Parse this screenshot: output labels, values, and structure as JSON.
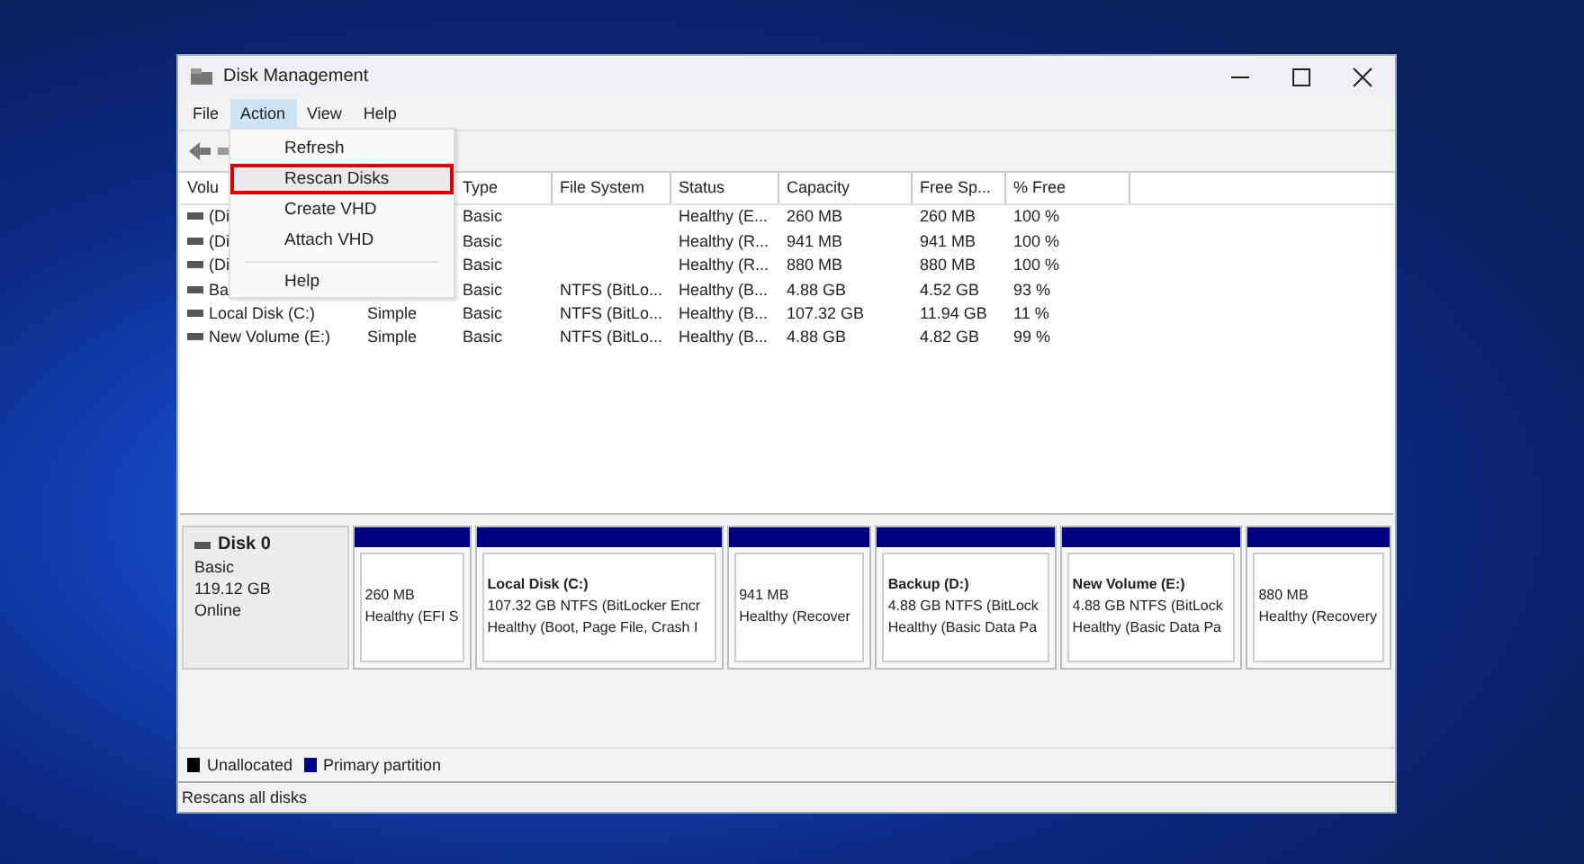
{
  "window": {
    "title": "Disk Management"
  },
  "menu_bar": [
    {
      "label": "File",
      "selected": false
    },
    {
      "label": "Action",
      "selected": true
    },
    {
      "label": "View",
      "selected": false
    },
    {
      "label": "Help",
      "selected": false
    }
  ],
  "action_menu": [
    {
      "kind": "item",
      "label": "Refresh",
      "selected": false
    },
    {
      "kind": "item",
      "label": "Rescan Disks",
      "selected": true
    },
    {
      "kind": "item",
      "label": "Create VHD",
      "selected": false
    },
    {
      "kind": "item",
      "label": "Attach VHD",
      "selected": false
    },
    {
      "kind": "separator"
    },
    {
      "kind": "item",
      "label": "Help",
      "selected": false
    }
  ],
  "table": {
    "columns": [
      "Volu",
      null,
      "Type",
      "File System",
      "Status",
      "Capacity",
      "Free Sp...",
      "% Free"
    ],
    "rows": [
      [
        "(Di",
        null,
        "Basic",
        null,
        "Healthy (E...",
        "260 MB",
        "260 MB",
        "100 %"
      ],
      [
        "(Di",
        null,
        "Basic",
        null,
        "Healthy (R...",
        "941 MB",
        "941 MB",
        "100 %"
      ],
      [
        "(Di",
        null,
        "Basic",
        null,
        "Healthy (R...",
        "880 MB",
        "880 MB",
        "100 %"
      ],
      [
        "Ba",
        null,
        "Basic",
        "NTFS (BitLo...",
        "Healthy (B...",
        "4.88 GB",
        "4.52 GB",
        "93 %"
      ],
      [
        "Local Disk (C:)",
        "Simple",
        "Basic",
        "NTFS (BitLo...",
        "Healthy (B...",
        "107.32 GB",
        "11.94 GB",
        "11 %"
      ],
      [
        "New Volume (E:)",
        "Simple",
        "Basic",
        "NTFS (BitLo...",
        "Healthy (B...",
        "4.88 GB",
        "4.82 GB",
        "99 %"
      ]
    ]
  },
  "disk": {
    "name": "Disk 0",
    "type": "Basic",
    "size": "119.12 GB",
    "state": "Online",
    "partitions": [
      {
        "line1": "260 MB",
        "line2": "Healthy (EFI S"
      },
      {
        "title": "Local Disk  (C:)",
        "line1": "107.32 GB NTFS (BitLocker Encr",
        "line2": "Healthy (Boot, Page File, Crash I"
      },
      {
        "line1": "941 MB",
        "line2": "Healthy (Recover"
      },
      {
        "title": "Backup  (D:)",
        "line1": "4.88 GB NTFS (BitLock",
        "line2": "Healthy (Basic Data Pa"
      },
      {
        "title": "New Volume  (E:)",
        "line1": "4.88 GB NTFS (BitLock",
        "line2": "Healthy (Basic Data Pa"
      },
      {
        "line1": "880 MB",
        "line2": "Healthy (Recovery"
      }
    ]
  },
  "legend": [
    {
      "label": "Unallocated",
      "color": "#000000"
    },
    {
      "label": "Primary partition",
      "color": "#000080"
    }
  ],
  "status_bar": "Rescans all disks"
}
